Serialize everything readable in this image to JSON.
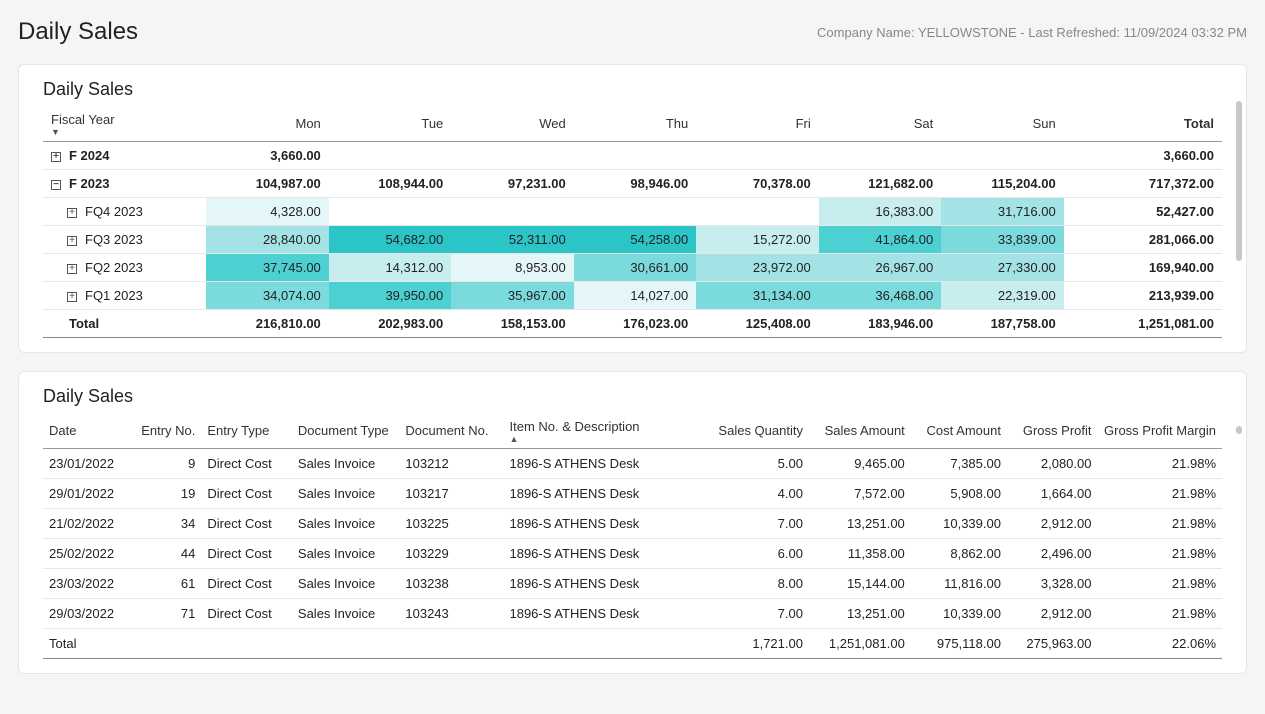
{
  "page": {
    "title": "Daily Sales",
    "meta": "Company Name: YELLOWSTONE - Last Refreshed: 11/09/2024 03:32 PM"
  },
  "pivot": {
    "title": "Daily Sales",
    "cols": {
      "group": "Fiscal Year",
      "mon": "Mon",
      "tue": "Tue",
      "wed": "Wed",
      "thu": "Thu",
      "fri": "Fri",
      "sat": "Sat",
      "sun": "Sun",
      "total": "Total"
    },
    "rows": [
      {
        "type": "year",
        "expand": "plus",
        "label": "F 2024",
        "vals": [
          "3,660.00",
          "",
          "",
          "",
          "",
          "",
          "",
          "3,660.00"
        ],
        "hc": [
          "",
          "",
          "",
          "",
          "",
          "",
          "",
          ""
        ]
      },
      {
        "type": "year",
        "expand": "minus",
        "label": "F 2023",
        "vals": [
          "104,987.00",
          "108,944.00",
          "97,231.00",
          "98,946.00",
          "70,378.00",
          "121,682.00",
          "115,204.00",
          "717,372.00"
        ],
        "hc": [
          "",
          "",
          "",
          "",
          "",
          "",
          "",
          ""
        ]
      },
      {
        "type": "quarter",
        "expand": "plus",
        "label": "FQ4 2023",
        "vals": [
          "4,328.00",
          "",
          "",
          "",
          "",
          "16,383.00",
          "31,716.00",
          "52,427.00"
        ],
        "hc": [
          "hc0",
          "",
          "",
          "",
          "",
          "hc1",
          "hc2",
          ""
        ]
      },
      {
        "type": "quarter",
        "expand": "plus",
        "label": "FQ3 2023",
        "vals": [
          "28,840.00",
          "54,682.00",
          "52,311.00",
          "54,258.00",
          "15,272.00",
          "41,864.00",
          "33,839.00",
          "281,066.00"
        ],
        "hc": [
          "hc2",
          "hc5",
          "hc5",
          "hc5",
          "hc1",
          "hc4",
          "hc3",
          ""
        ]
      },
      {
        "type": "quarter",
        "expand": "plus",
        "label": "FQ2 2023",
        "vals": [
          "37,745.00",
          "14,312.00",
          "8,953.00",
          "30,661.00",
          "23,972.00",
          "26,967.00",
          "27,330.00",
          "169,940.00"
        ],
        "hc": [
          "hc4",
          "hc1",
          "hc0",
          "hc3",
          "hc2",
          "hc2",
          "hc2",
          ""
        ]
      },
      {
        "type": "quarter",
        "expand": "plus",
        "label": "FQ1 2023",
        "vals": [
          "34,074.00",
          "39,950.00",
          "35,967.00",
          "14,027.00",
          "31,134.00",
          "36,468.00",
          "22,319.00",
          "213,939.00"
        ],
        "hc": [
          "hc3",
          "hc4",
          "hc3",
          "hc0",
          "hc3",
          "hc3",
          "hc1",
          ""
        ]
      }
    ],
    "total": {
      "label": "Total",
      "vals": [
        "216,810.00",
        "202,983.00",
        "158,153.00",
        "176,023.00",
        "125,408.00",
        "183,946.00",
        "187,758.00",
        "1,251,081.00"
      ]
    }
  },
  "detail": {
    "title": "Daily Sales",
    "cols": [
      "Date",
      "Entry No.",
      "Entry Type",
      "Document Type",
      "Document No.",
      "Item No. & Description",
      "Sales Quantity",
      "Sales Amount",
      "Cost Amount",
      "Gross Profit",
      "Gross Profit Margin"
    ],
    "rows": [
      {
        "date": "23/01/2022",
        "entryno": "9",
        "entrytype": "Direct Cost",
        "doctype": "Sales Invoice",
        "docno": "103212",
        "item": "1896-S ATHENS Desk",
        "qty": "5.00",
        "sales": "9,465.00",
        "cost": "7,385.00",
        "profit": "2,080.00",
        "margin": "21.98%"
      },
      {
        "date": "29/01/2022",
        "entryno": "19",
        "entrytype": "Direct Cost",
        "doctype": "Sales Invoice",
        "docno": "103217",
        "item": "1896-S ATHENS Desk",
        "qty": "4.00",
        "sales": "7,572.00",
        "cost": "5,908.00",
        "profit": "1,664.00",
        "margin": "21.98%"
      },
      {
        "date": "21/02/2022",
        "entryno": "34",
        "entrytype": "Direct Cost",
        "doctype": "Sales Invoice",
        "docno": "103225",
        "item": "1896-S ATHENS Desk",
        "qty": "7.00",
        "sales": "13,251.00",
        "cost": "10,339.00",
        "profit": "2,912.00",
        "margin": "21.98%"
      },
      {
        "date": "25/02/2022",
        "entryno": "44",
        "entrytype": "Direct Cost",
        "doctype": "Sales Invoice",
        "docno": "103229",
        "item": "1896-S ATHENS Desk",
        "qty": "6.00",
        "sales": "11,358.00",
        "cost": "8,862.00",
        "profit": "2,496.00",
        "margin": "21.98%"
      },
      {
        "date": "23/03/2022",
        "entryno": "61",
        "entrytype": "Direct Cost",
        "doctype": "Sales Invoice",
        "docno": "103238",
        "item": "1896-S ATHENS Desk",
        "qty": "8.00",
        "sales": "15,144.00",
        "cost": "11,816.00",
        "profit": "3,328.00",
        "margin": "21.98%"
      },
      {
        "date": "29/03/2022",
        "entryno": "71",
        "entrytype": "Direct Cost",
        "doctype": "Sales Invoice",
        "docno": "103243",
        "item": "1896-S ATHENS Desk",
        "qty": "7.00",
        "sales": "13,251.00",
        "cost": "10,339.00",
        "profit": "2,912.00",
        "margin": "21.98%"
      }
    ],
    "total": {
      "label": "Total",
      "qty": "1,721.00",
      "sales": "1,251,081.00",
      "cost": "975,118.00",
      "profit": "275,963.00",
      "margin": "22.06%"
    }
  }
}
